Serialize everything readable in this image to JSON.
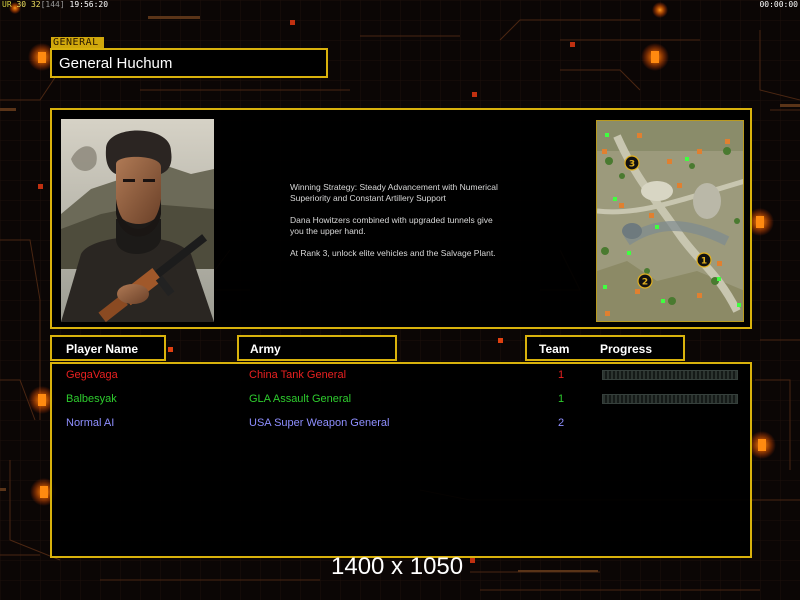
{
  "hud": {
    "ur": "UR",
    "fps": "30",
    "fps_detail": "32",
    "memory": "[144]",
    "clock": "19:56:20",
    "timer": "00:00:00"
  },
  "general": {
    "tag": "GENERAL",
    "name": "General Huchum"
  },
  "strategy": {
    "lines": [
      "Winning Strategy: Steady Advancement with Numerical\n Superiority and Constant Artillery Support",
      "Dana Howitzers combined with upgraded tunnels give\n you the upper hand.",
      "At Rank 3, unlock elite vehicles and the Salvage Plant."
    ]
  },
  "minimap": {
    "markers": [
      "1",
      "2",
      "3"
    ]
  },
  "table": {
    "headers": {
      "player": "Player Name",
      "army": "Army",
      "team": "Team",
      "progress": "Progress"
    },
    "rows": [
      {
        "name": "GegaVaga",
        "army": "China Tank General",
        "team": "1",
        "color": "#e82020",
        "progress": 0
      },
      {
        "name": "Balbesyak",
        "army": "GLA Assault General",
        "team": "1",
        "color": "#2ecc2e",
        "progress": 0
      },
      {
        "name": "Normal AI",
        "army": "USA Super Weapon General",
        "team": "2",
        "color": "#8f8fff",
        "progress": null
      }
    ]
  },
  "resolution_label": "1400 x 1050",
  "colors": {
    "frame_gold": "#d9b20c",
    "glow_orange": "#ff7a10",
    "china_red": "#e82020",
    "gla_green": "#2ecc2e",
    "usa_blue": "#8f8fff"
  }
}
